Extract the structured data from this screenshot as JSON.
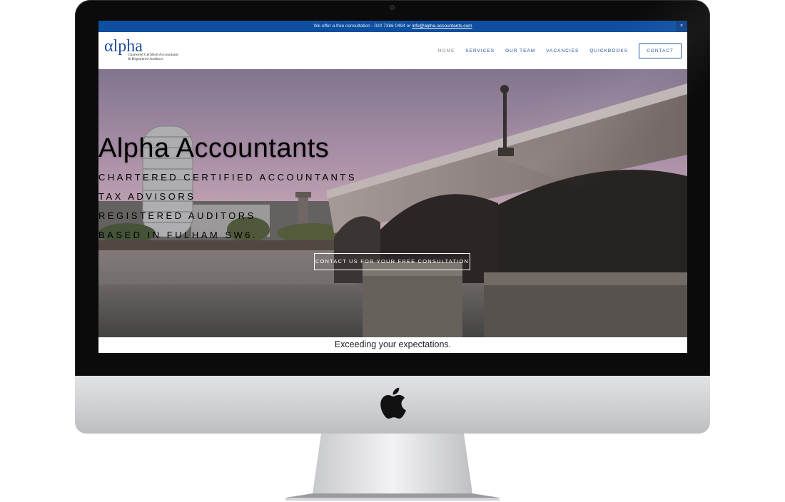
{
  "announcement": {
    "text": "We offer a free consultation - 020 7386 0494 or ",
    "email": "info@alpha-accountants.com",
    "close_label": "×"
  },
  "logo": {
    "mark": "αlpha",
    "line1": "Chartered Certified Accountants",
    "line2": "& Registered Auditors"
  },
  "nav": {
    "items": [
      {
        "label": "HOME",
        "active": true
      },
      {
        "label": "SERVICES"
      },
      {
        "label": "OUR TEAM"
      },
      {
        "label": "VACANCIES"
      },
      {
        "label": "QUICKBOOKS"
      }
    ],
    "contact_label": "CONTACT"
  },
  "hero": {
    "title": "Alpha Accountants",
    "lines": [
      "CHARTERED CERTIFIED ACCOUNTANTS",
      "TAX ADVISORS",
      "REGISTERED AUDITORS",
      "BASED IN FULHAM SW6."
    ],
    "cta_label": "CONTACT US FOR YOUR FREE CONSULTATION"
  },
  "tagline": "Exceeding your expectations.",
  "colors": {
    "brand_blue": "#1f4f9c",
    "announcement_bg": "#0f4fa0"
  },
  "icons": {
    "apple_logo": "apple-logo-icon",
    "close": "close-icon",
    "camera": "camera-dot"
  }
}
